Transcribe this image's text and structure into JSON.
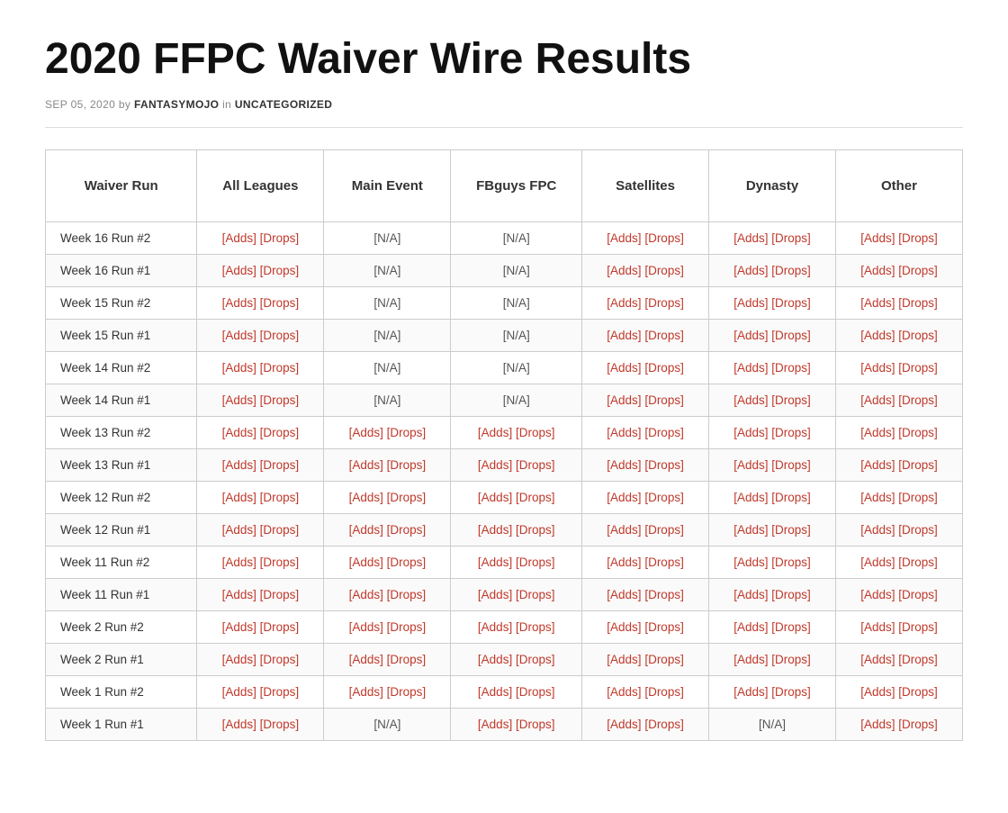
{
  "page": {
    "title": "2020 FFPC Waiver Wire Results",
    "meta": {
      "date": "SEP 05, 2020",
      "by": "by",
      "author": "FANTASYMOJO",
      "in": "in",
      "category": "UNCATEGORIZED"
    }
  },
  "table": {
    "headers": [
      "Waiver Run",
      "All Leagues",
      "Main Event",
      "FBguys FPC",
      "Satellites",
      "Dynasty",
      "Other"
    ],
    "rows": [
      {
        "run": "Week 16 Run #2",
        "all_leagues": {
          "adds": "[Adds]",
          "drops": "[Drops]"
        },
        "main_event": {
          "na": "[N/A]"
        },
        "fbguys": {
          "na": "[N/A]"
        },
        "satellites": {
          "adds": "[Adds]",
          "drops": "[Drops]"
        },
        "dynasty": {
          "adds": "[Adds]",
          "drops": "[Drops]"
        },
        "other": {
          "adds": "[Adds]",
          "drops": "[Drops]"
        }
      },
      {
        "run": "Week 16 Run #1",
        "all_leagues": {
          "adds": "[Adds]",
          "drops": "[Drops]"
        },
        "main_event": {
          "na": "[N/A]"
        },
        "fbguys": {
          "na": "[N/A]"
        },
        "satellites": {
          "adds": "[Adds]",
          "drops": "[Drops]"
        },
        "dynasty": {
          "adds": "[Adds]",
          "drops": "[Drops]"
        },
        "other": {
          "adds": "[Adds]",
          "drops": "[Drops]"
        }
      },
      {
        "run": "Week 15 Run #2",
        "all_leagues": {
          "adds": "[Adds]",
          "drops": "[Drops]"
        },
        "main_event": {
          "na": "[N/A]"
        },
        "fbguys": {
          "na": "[N/A]"
        },
        "satellites": {
          "adds": "[Adds]",
          "drops": "[Drops]"
        },
        "dynasty": {
          "adds": "[Adds]",
          "drops": "[Drops]"
        },
        "other": {
          "adds": "[Adds]",
          "drops": "[Drops]"
        }
      },
      {
        "run": "Week 15 Run #1",
        "all_leagues": {
          "adds": "[Adds]",
          "drops": "[Drops]"
        },
        "main_event": {
          "na": "[N/A]"
        },
        "fbguys": {
          "na": "[N/A]"
        },
        "satellites": {
          "adds": "[Adds]",
          "drops": "[Drops]"
        },
        "dynasty": {
          "adds": "[Adds]",
          "drops": "[Drops]"
        },
        "other": {
          "adds": "[Adds]",
          "drops": "[Drops]"
        }
      },
      {
        "run": "Week 14 Run #2",
        "all_leagues": {
          "adds": "[Adds]",
          "drops": "[Drops]"
        },
        "main_event": {
          "na": "[N/A]"
        },
        "fbguys": {
          "na": "[N/A]"
        },
        "satellites": {
          "adds": "[Adds]",
          "drops": "[Drops]"
        },
        "dynasty": {
          "adds": "[Adds]",
          "drops": "[Drops]"
        },
        "other": {
          "adds": "[Adds]",
          "drops": "[Drops]"
        }
      },
      {
        "run": "Week 14 Run #1",
        "all_leagues": {
          "adds": "[Adds]",
          "drops": "[Drops]"
        },
        "main_event": {
          "na": "[N/A]"
        },
        "fbguys": {
          "na": "[N/A]"
        },
        "satellites": {
          "adds": "[Adds]",
          "drops": "[Drops]"
        },
        "dynasty": {
          "adds": "[Adds]",
          "drops": "[Drops]"
        },
        "other": {
          "adds": "[Adds]",
          "drops": "[Drops]"
        }
      },
      {
        "run": "Week 13 Run #2",
        "all_leagues": {
          "adds": "[Adds]",
          "drops": "[Drops]"
        },
        "main_event": {
          "adds": "[Adds]",
          "drops": "[Drops]"
        },
        "fbguys": {
          "adds": "[Adds]",
          "drops": "[Drops]"
        },
        "satellites": {
          "adds": "[Adds]",
          "drops": "[Drops]"
        },
        "dynasty": {
          "adds": "[Adds]",
          "drops": "[Drops]"
        },
        "other": {
          "adds": "[Adds]",
          "drops": "[Drops]"
        }
      },
      {
        "run": "Week 13 Run #1",
        "all_leagues": {
          "adds": "[Adds]",
          "drops": "[Drops]"
        },
        "main_event": {
          "adds": "[Adds]",
          "drops": "[Drops]"
        },
        "fbguys": {
          "adds": "[Adds]",
          "drops": "[Drops]"
        },
        "satellites": {
          "adds": "[Adds]",
          "drops": "[Drops]"
        },
        "dynasty": {
          "adds": "[Adds]",
          "drops": "[Drops]"
        },
        "other": {
          "adds": "[Adds]",
          "drops": "[Drops]"
        }
      },
      {
        "run": "Week 12 Run #2",
        "all_leagues": {
          "adds": "[Adds]",
          "drops": "[Drops]"
        },
        "main_event": {
          "adds": "[Adds]",
          "drops": "[Drops]"
        },
        "fbguys": {
          "adds": "[Adds]",
          "drops": "[Drops]"
        },
        "satellites": {
          "adds": "[Adds]",
          "drops": "[Drops]"
        },
        "dynasty": {
          "adds": "[Adds]",
          "drops": "[Drops]"
        },
        "other": {
          "adds": "[Adds]",
          "drops": "[Drops]"
        }
      },
      {
        "run": "Week 12 Run #1",
        "all_leagues": {
          "adds": "[Adds]",
          "drops": "[Drops]"
        },
        "main_event": {
          "adds": "[Adds]",
          "drops": "[Drops]"
        },
        "fbguys": {
          "adds": "[Adds]",
          "drops": "[Drops]"
        },
        "satellites": {
          "adds": "[Adds]",
          "drops": "[Drops]"
        },
        "dynasty": {
          "adds": "[Adds]",
          "drops": "[Drops]"
        },
        "other": {
          "adds": "[Adds]",
          "drops": "[Drops]"
        }
      },
      {
        "run": "Week 11 Run #2",
        "all_leagues": {
          "adds": "[Adds]",
          "drops": "[Drops]"
        },
        "main_event": {
          "adds": "[Adds]",
          "drops": "[Drops]"
        },
        "fbguys": {
          "adds": "[Adds]",
          "drops": "[Drops]"
        },
        "satellites": {
          "adds": "[Adds]",
          "drops": "[Drops]"
        },
        "dynasty": {
          "adds": "[Adds]",
          "drops": "[Drops]"
        },
        "other": {
          "adds": "[Adds]",
          "drops": "[Drops]"
        }
      },
      {
        "run": "Week 11 Run #1",
        "all_leagues": {
          "adds": "[Adds]",
          "drops": "[Drops]"
        },
        "main_event": {
          "adds": "[Adds]",
          "drops": "[Drops]"
        },
        "fbguys": {
          "adds": "[Adds]",
          "drops": "[Drops]"
        },
        "satellites": {
          "adds": "[Adds]",
          "drops": "[Drops]"
        },
        "dynasty": {
          "adds": "[Adds]",
          "drops": "[Drops]"
        },
        "other": {
          "adds": "[Adds]",
          "drops": "[Drops]"
        }
      },
      {
        "run": "Week 2 Run #2",
        "all_leagues": {
          "adds": "[Adds]",
          "drops": "[Drops]"
        },
        "main_event": {
          "adds": "[Adds]",
          "drops": "[Drops]"
        },
        "fbguys": {
          "adds": "[Adds]",
          "drops": "[Drops]"
        },
        "satellites": {
          "adds": "[Adds]",
          "drops": "[Drops]"
        },
        "dynasty": {
          "adds": "[Adds]",
          "drops": "[Drops]"
        },
        "other": {
          "adds": "[Adds]",
          "drops": "[Drops]"
        }
      },
      {
        "run": "Week 2 Run #1",
        "all_leagues": {
          "adds": "[Adds]",
          "drops": "[Drops]"
        },
        "main_event": {
          "adds": "[Adds]",
          "drops": "[Drops]"
        },
        "fbguys": {
          "adds": "[Adds]",
          "drops": "[Drops]"
        },
        "satellites": {
          "adds": "[Adds]",
          "drops": "[Drops]"
        },
        "dynasty": {
          "adds": "[Adds]",
          "drops": "[Drops]"
        },
        "other": {
          "adds": "[Adds]",
          "drops": "[Drops]"
        }
      },
      {
        "run": "Week 1 Run #2",
        "all_leagues": {
          "adds": "[Adds]",
          "drops": "[Drops]"
        },
        "main_event": {
          "adds": "[Adds]",
          "drops": "[Drops]"
        },
        "fbguys": {
          "adds": "[Adds]",
          "drops": "[Drops]"
        },
        "satellites": {
          "adds": "[Adds]",
          "drops": "[Drops]"
        },
        "dynasty": {
          "adds": "[Adds]",
          "drops": "[Drops]"
        },
        "other": {
          "adds": "[Adds]",
          "drops": "[Drops]"
        }
      },
      {
        "run": "Week 1 Run #1",
        "all_leagues": {
          "adds": "[Adds]",
          "drops": "[Drops]"
        },
        "main_event": {
          "na": "[N/A]"
        },
        "fbguys": {
          "adds": "[Adds]",
          "drops": "[Drops]"
        },
        "satellites": {
          "adds": "[Adds]",
          "drops": "[Drops]"
        },
        "dynasty": {
          "na": "[N/A]"
        },
        "other": {
          "adds": "[Adds]",
          "drops": "[Drops]"
        }
      }
    ]
  }
}
